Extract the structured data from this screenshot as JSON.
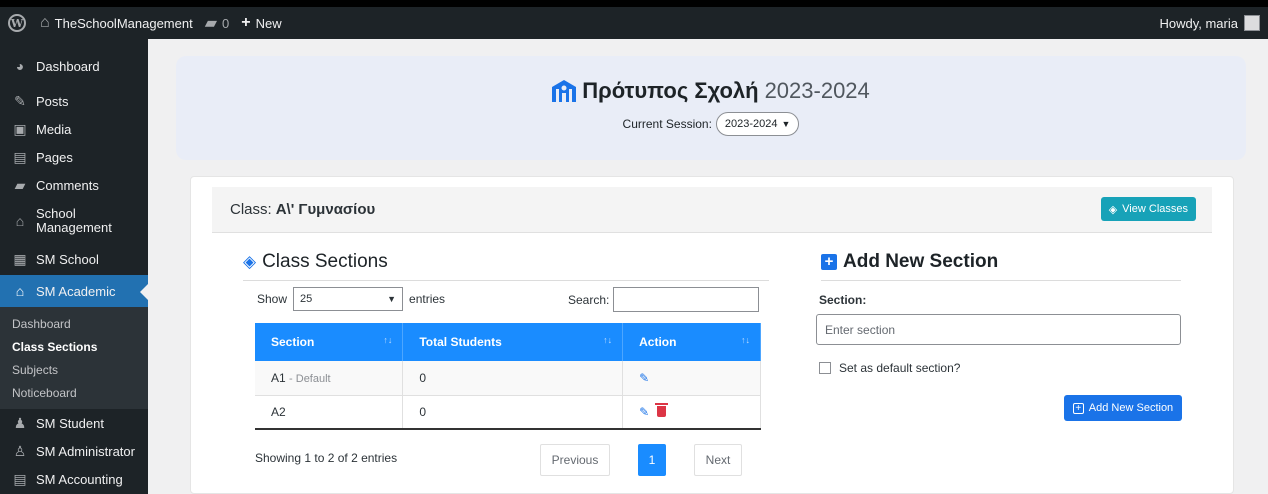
{
  "adminbar": {
    "site_name": "TheSchoolManagement",
    "comments_count": "0",
    "new_label": "New",
    "howdy": "Howdy, maria"
  },
  "sidebar": {
    "items": [
      {
        "label": "Dashboard",
        "icon": "dashboard-icon"
      },
      {
        "label": "Posts",
        "icon": "pin-icon"
      },
      {
        "label": "Media",
        "icon": "media-icon"
      },
      {
        "label": "Pages",
        "icon": "pages-icon"
      },
      {
        "label": "Comments",
        "icon": "comment-icon"
      },
      {
        "label": "School Management",
        "icon": "graduation-cap-icon"
      },
      {
        "label": "SM School",
        "icon": "building-icon"
      },
      {
        "label": "SM Academic",
        "icon": "graduation-cap-icon"
      }
    ],
    "submenu": [
      "Dashboard",
      "Class Sections",
      "Subjects",
      "Noticeboard"
    ],
    "items_after": [
      {
        "label": "SM Student",
        "icon": "users-icon"
      },
      {
        "label": "SM Administrator",
        "icon": "admin-icon"
      },
      {
        "label": "SM Accounting",
        "icon": "receipt-icon"
      }
    ]
  },
  "header": {
    "school_name": "Πρότυπος Σχολή",
    "year": "2023-2024",
    "session_label": "Current Session:",
    "session_value": "2023-2024"
  },
  "class": {
    "label": "Class:",
    "name": "A\\' Γυμνασίου",
    "view_classes": "View Classes"
  },
  "sections": {
    "title": "Class Sections",
    "show_label": "Show",
    "entries_value": "25",
    "entries_label": "entries",
    "search_label": "Search:",
    "columns": [
      "Section",
      "Total Students",
      "Action"
    ],
    "rows": [
      {
        "section": "A1",
        "default_tag": "- Default",
        "total": "0"
      },
      {
        "section": "A2",
        "default_tag": "",
        "total": "0"
      }
    ],
    "showing": "Showing 1 to 2 of 2 entries",
    "prev": "Previous",
    "page": "1",
    "next": "Next"
  },
  "add_section": {
    "title": "Add New Section",
    "section_label": "Section:",
    "placeholder": "Enter section",
    "default_label": "Set as default section?",
    "button": "Add New Section"
  },
  "colors": {
    "accent": "#1a73e8",
    "table_header": "#1a8cff",
    "teal": "#17a2b8",
    "sidebar": "#1d2327",
    "active": "#2271b1",
    "danger": "#dc3545"
  }
}
